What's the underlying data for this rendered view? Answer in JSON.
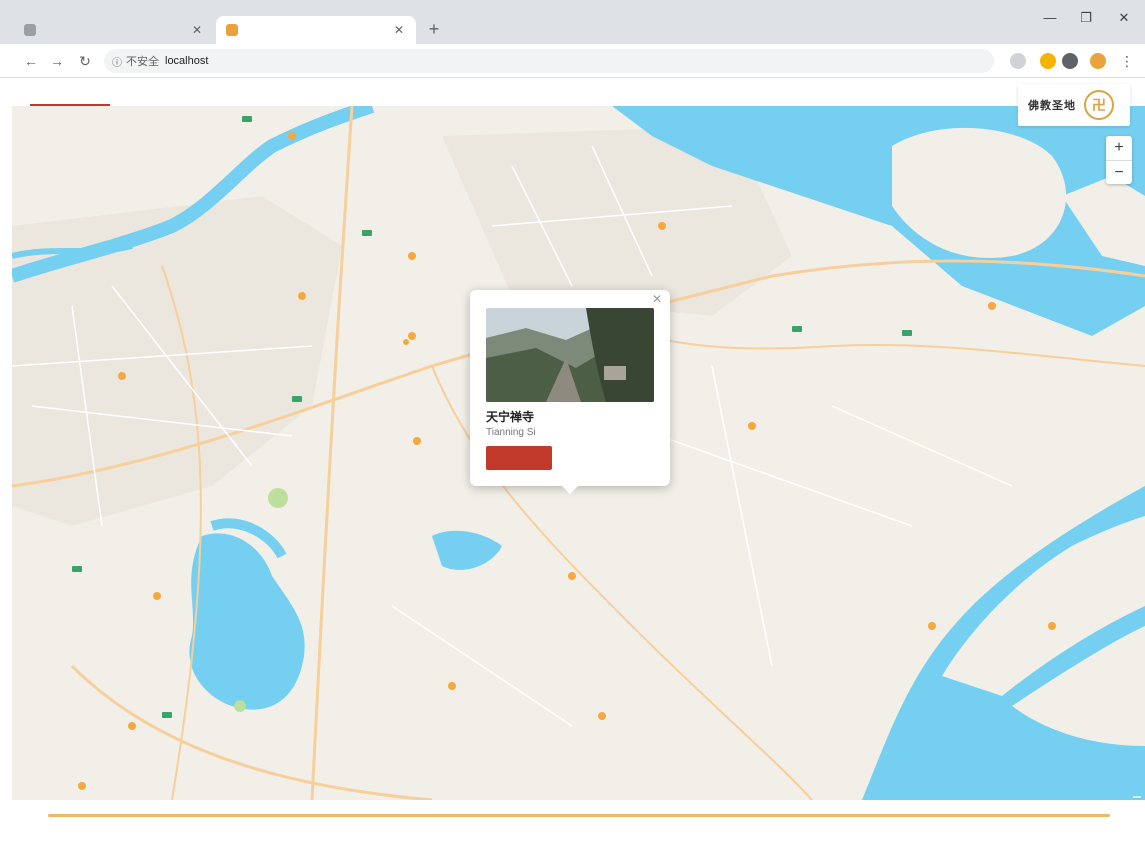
{
  "browser": {
    "tabs": [
      {
        "title": "",
        "active": false
      },
      {
        "title": "",
        "active": true
      }
    ],
    "address": {
      "security_text": "不安全",
      "url": "localhost"
    }
  },
  "app": {
    "nav_tabs": [
      "",
      ""
    ],
    "logo_text": "佛教圣地"
  },
  "map": {
    "zoom_in": "+",
    "zoom_out": "−",
    "attribution": ""
  },
  "popup": {
    "title": "天宁禅寺",
    "subtitle": "Tianning Si",
    "button_label": ""
  },
  "colors": {
    "accent": "#c0392b",
    "water": "#75cff0",
    "land": "#f2efe8",
    "road": "#f6cf9a",
    "timeline": "#f0b865"
  }
}
